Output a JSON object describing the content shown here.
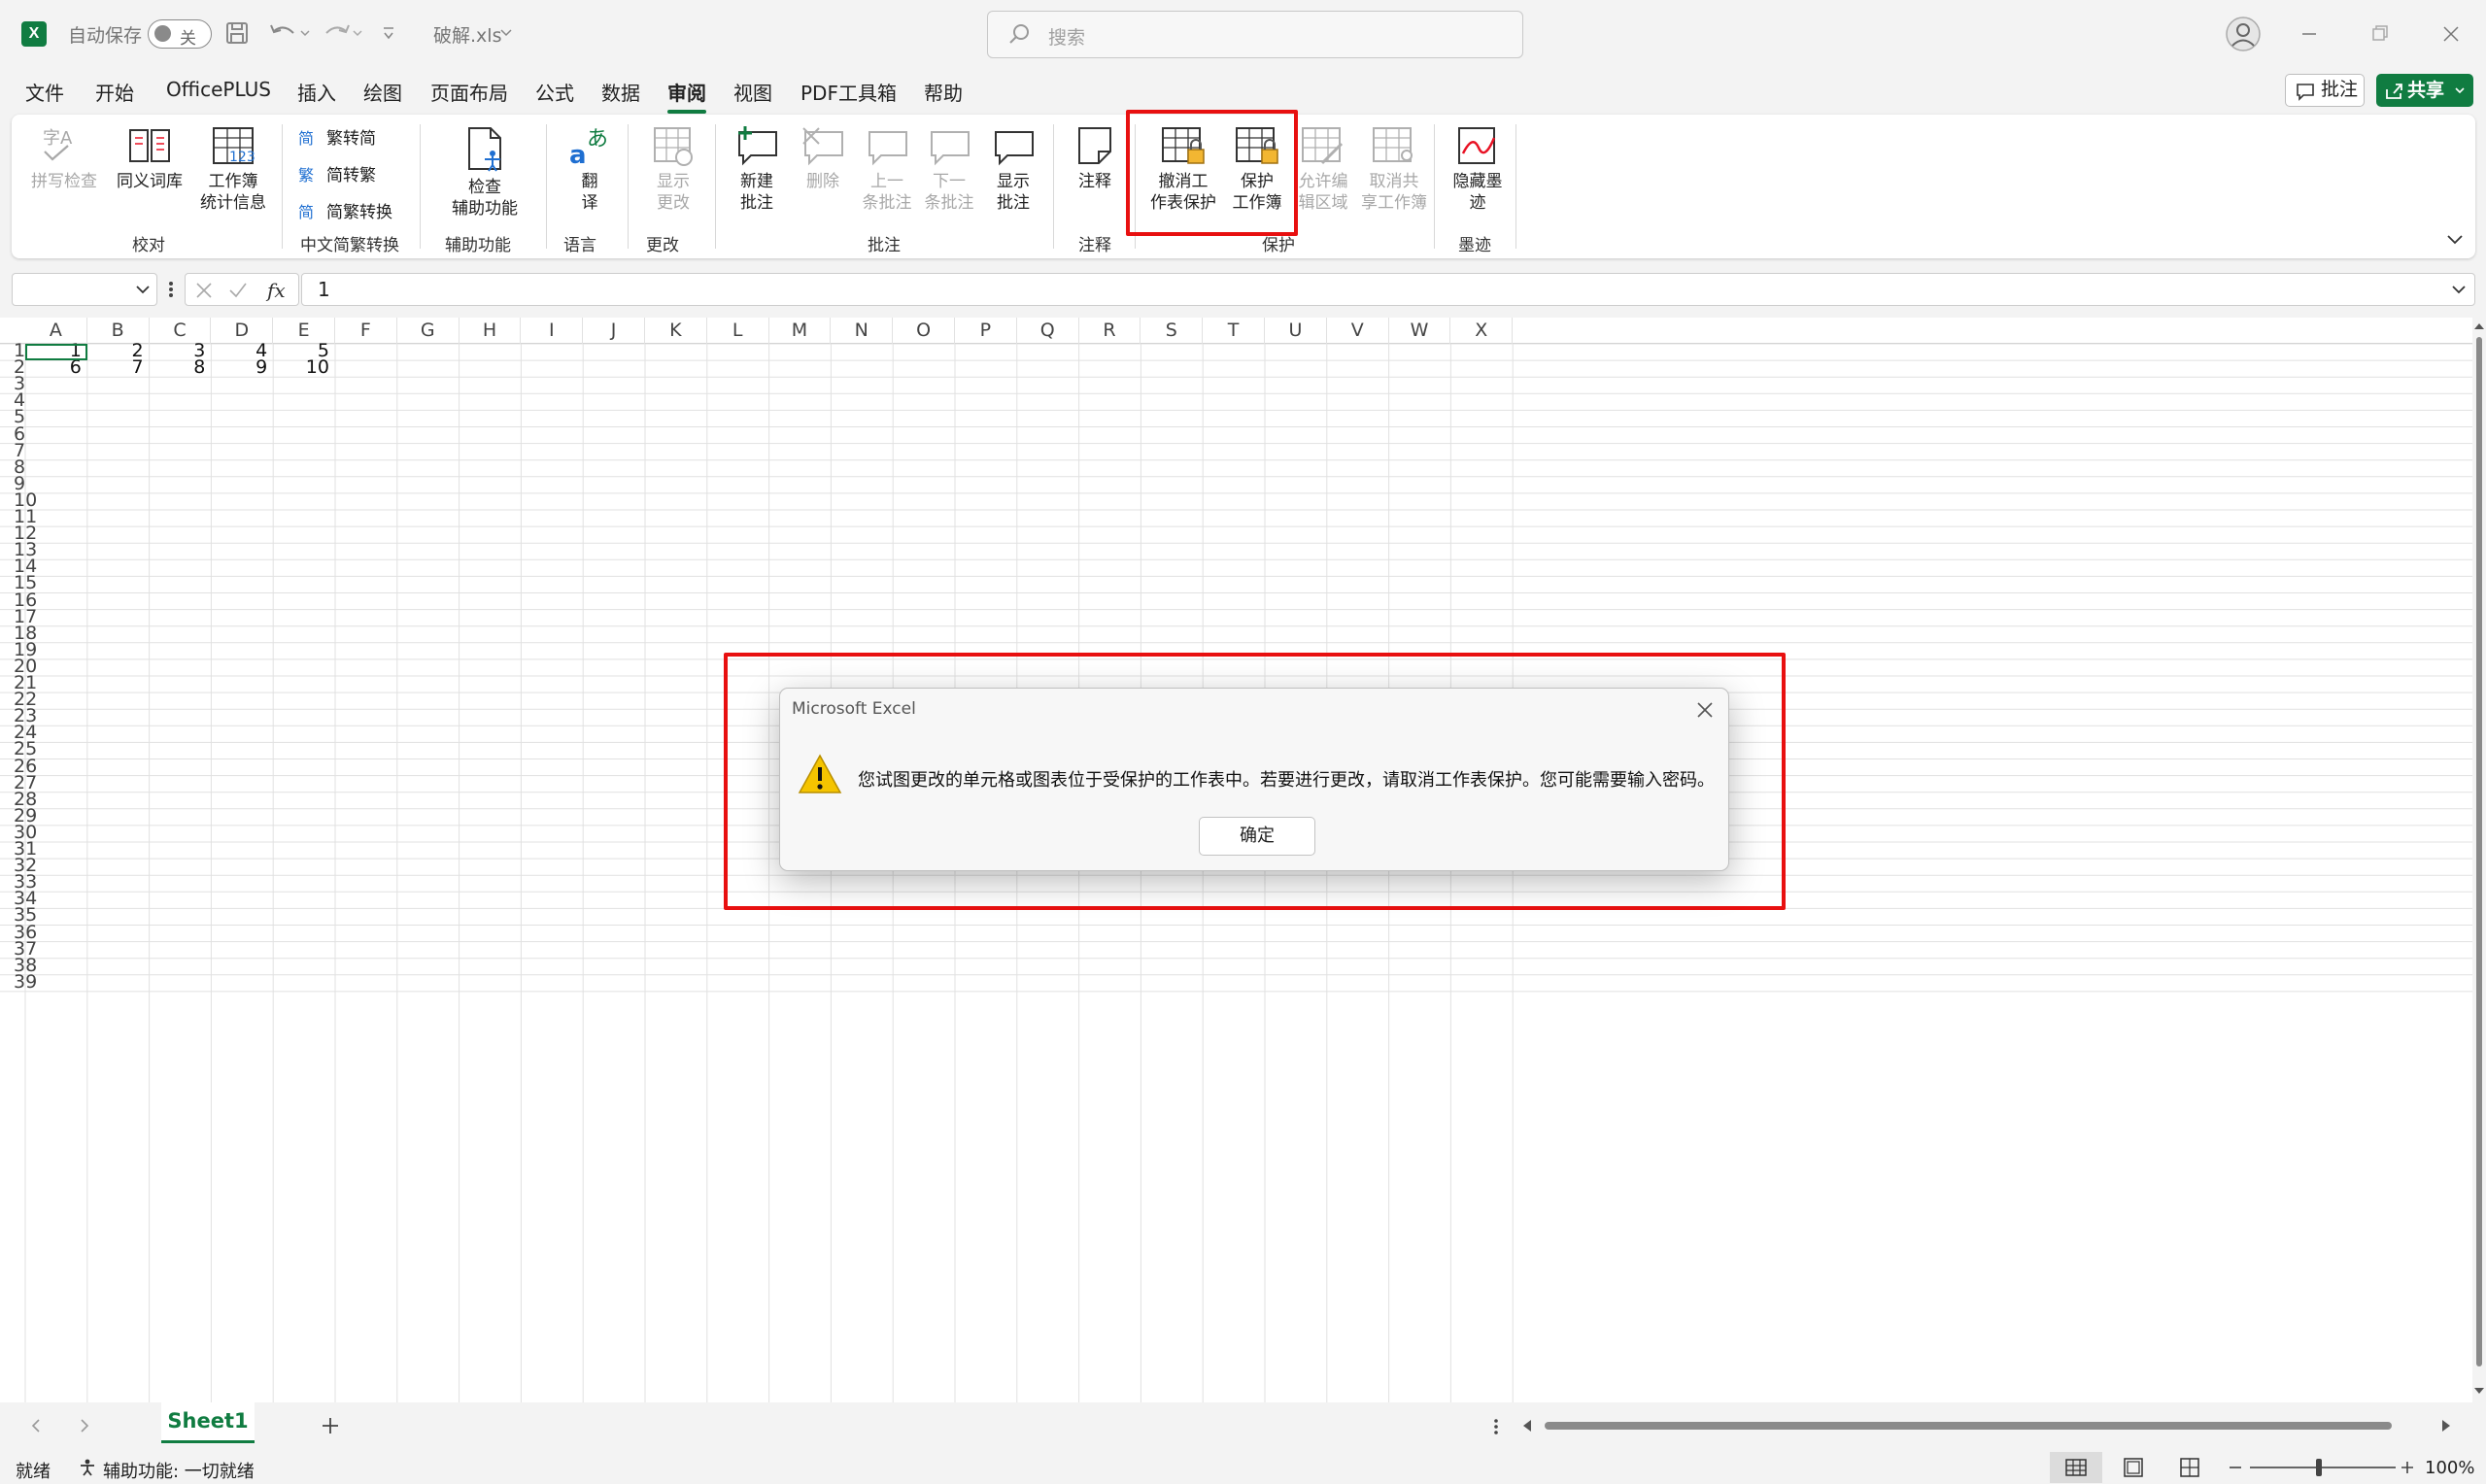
{
  "titlebar": {
    "autosave_label": "自动保存",
    "autosave_state": "关",
    "filename": "破解.xls",
    "search_placeholder": "搜索"
  },
  "menu": {
    "items": [
      "文件",
      "开始",
      "OfficePLUS",
      "插入",
      "绘图",
      "页面布局",
      "公式",
      "数据",
      "审阅",
      "视图",
      "PDF工具箱",
      "帮助"
    ],
    "active": "审阅",
    "comment_button": "批注",
    "share_button": "共享"
  },
  "ribbon": {
    "proofing": {
      "spell": "拼写检查",
      "thesaurus": "同义词库",
      "stats": [
        "工作簿",
        "统计信息"
      ],
      "group": "校对"
    },
    "chinese": {
      "t2s": "繁转简",
      "s2t": "简转繁",
      "convert": "简繁转换",
      "group": "中文简繁转换"
    },
    "accessibility": {
      "check": [
        "检查",
        "辅助功能"
      ],
      "group": "辅助功能"
    },
    "language": {
      "translate": [
        "翻",
        "译"
      ],
      "group": "语言"
    },
    "changes": {
      "show": [
        "显示",
        "更改"
      ],
      "group": "更改"
    },
    "comments": {
      "new": [
        "新建",
        "批注"
      ],
      "delete": "删除",
      "prev": [
        "上一",
        "条批注"
      ],
      "next": [
        "下一",
        "条批注"
      ],
      "show": [
        "显示",
        "批注"
      ],
      "group": "批注"
    },
    "notes": {
      "notes": "注释",
      "group": "注释"
    },
    "protect": {
      "unprotect_sheet": [
        "撤消工",
        "作表保护"
      ],
      "protect_workbook": [
        "保护",
        "工作簿"
      ],
      "allow_edit": [
        "允许编",
        "辑区域"
      ],
      "unshare": [
        "取消共",
        "享工作簿"
      ],
      "group": "保护"
    },
    "ink": {
      "hide": [
        "隐藏墨",
        "迹"
      ],
      "group": "墨迹"
    }
  },
  "formula": {
    "name_box": "",
    "value": "1"
  },
  "grid": {
    "columns": [
      "A",
      "B",
      "C",
      "D",
      "E",
      "F",
      "G",
      "H",
      "I",
      "J",
      "K",
      "L",
      "M",
      "N",
      "O",
      "P",
      "Q",
      "R",
      "S",
      "T",
      "U",
      "V",
      "W",
      "X"
    ],
    "rows": [
      "1",
      "2",
      "3",
      "4",
      "5",
      "6",
      "7",
      "8",
      "9",
      "10",
      "11",
      "12",
      "13",
      "14",
      "15",
      "16",
      "17",
      "18",
      "19",
      "20",
      "21",
      "22",
      "23",
      "24",
      "25",
      "26",
      "27",
      "28",
      "29",
      "30",
      "31",
      "32",
      "33",
      "34",
      "35",
      "36",
      "37",
      "38",
      "39"
    ],
    "values": [
      [
        "1",
        "2",
        "3",
        "4",
        "5"
      ],
      [
        "6",
        "7",
        "8",
        "9",
        "10"
      ]
    ]
  },
  "sheets": {
    "tabs": [
      "Sheet1"
    ]
  },
  "status": {
    "ready": "就绪",
    "accessibility": "辅助功能: 一切就绪",
    "zoom": "100%"
  },
  "dialog": {
    "title": "Microsoft Excel",
    "message": "您试图更改的单元格或图表位于受保护的工作表中。若要进行更改，请取消工作表保护。您可能需要输入密码。",
    "ok": "确定"
  },
  "colors": {
    "accent": "#107c41",
    "highlight": "#e81010",
    "warning": "#f5c400"
  }
}
